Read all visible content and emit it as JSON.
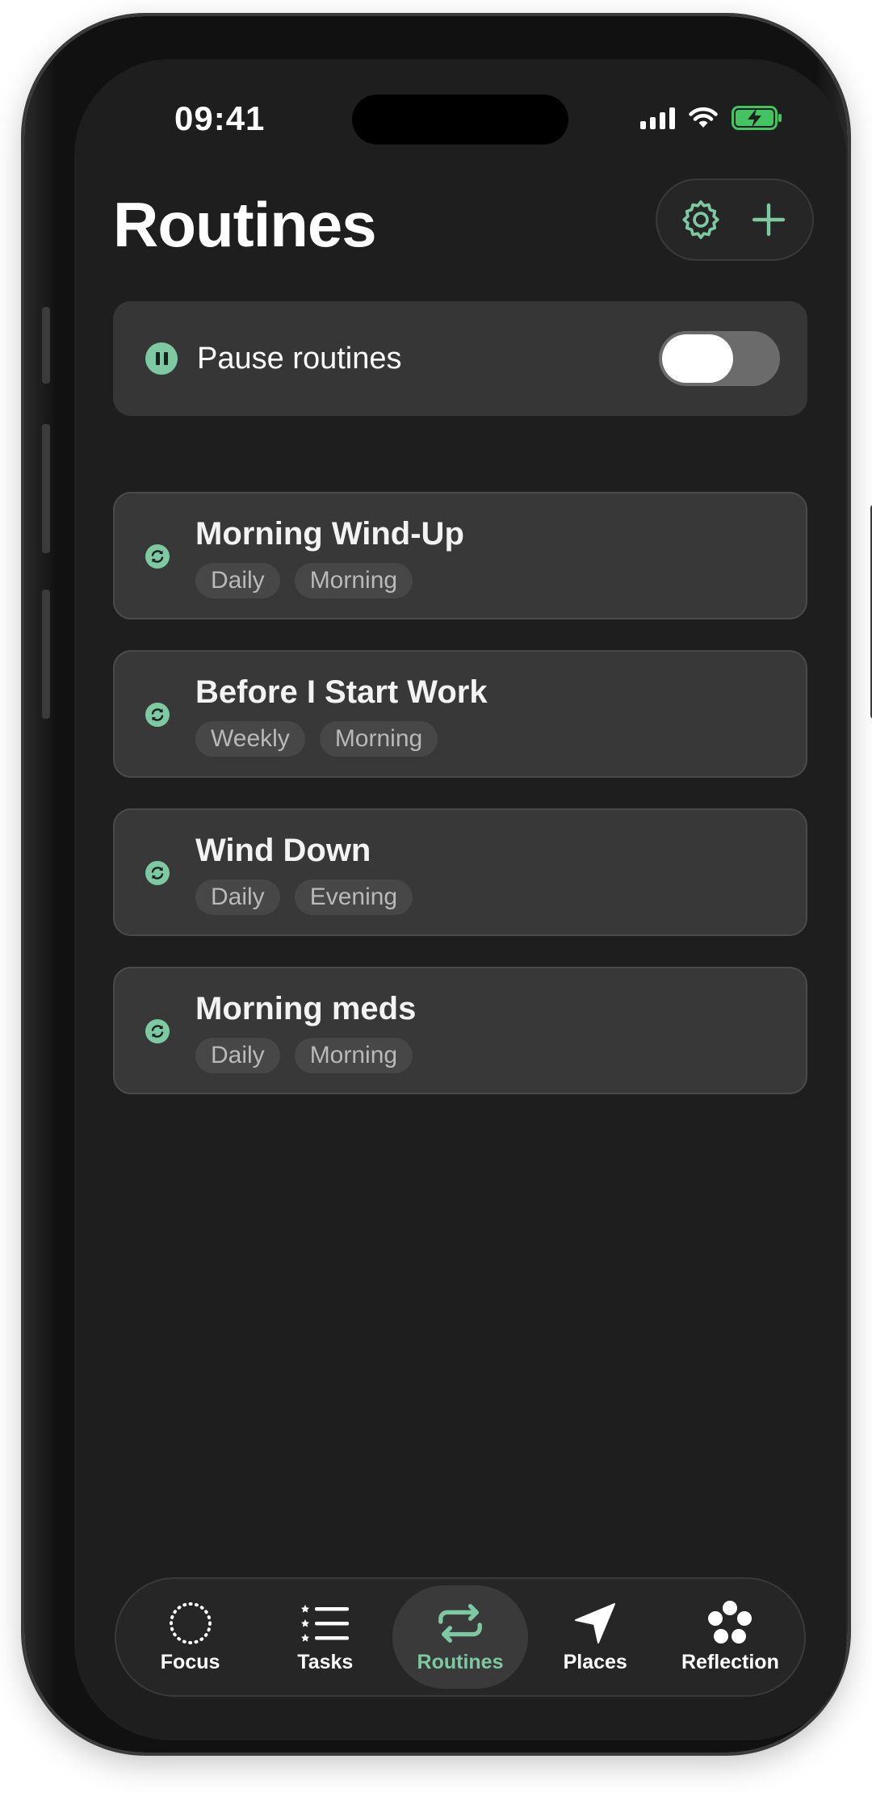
{
  "status_bar": {
    "time": "09:41"
  },
  "header": {
    "title": "Routines"
  },
  "pause": {
    "label": "Pause routines",
    "enabled": false
  },
  "routines": [
    {
      "name": "Morning Wind-Up",
      "tags": [
        "Daily",
        "Morning"
      ]
    },
    {
      "name": "Before I Start Work",
      "tags": [
        "Weekly",
        "Morning"
      ]
    },
    {
      "name": "Wind Down",
      "tags": [
        "Daily",
        "Evening"
      ]
    },
    {
      "name": "Morning meds",
      "tags": [
        "Daily",
        "Morning"
      ]
    }
  ],
  "tabbar": {
    "tabs": [
      {
        "label": "Focus",
        "icon": "focus-circle-icon"
      },
      {
        "label": "Tasks",
        "icon": "tasks-list-icon"
      },
      {
        "label": "Routines",
        "icon": "repeat-icon",
        "active": true
      },
      {
        "label": "Places",
        "icon": "location-arrow-icon"
      },
      {
        "label": "Reflection",
        "icon": "reflection-flower-icon"
      }
    ]
  },
  "colors": {
    "accent": "#7cc9a2",
    "background": "#1e1e1e",
    "card": "#383838"
  }
}
